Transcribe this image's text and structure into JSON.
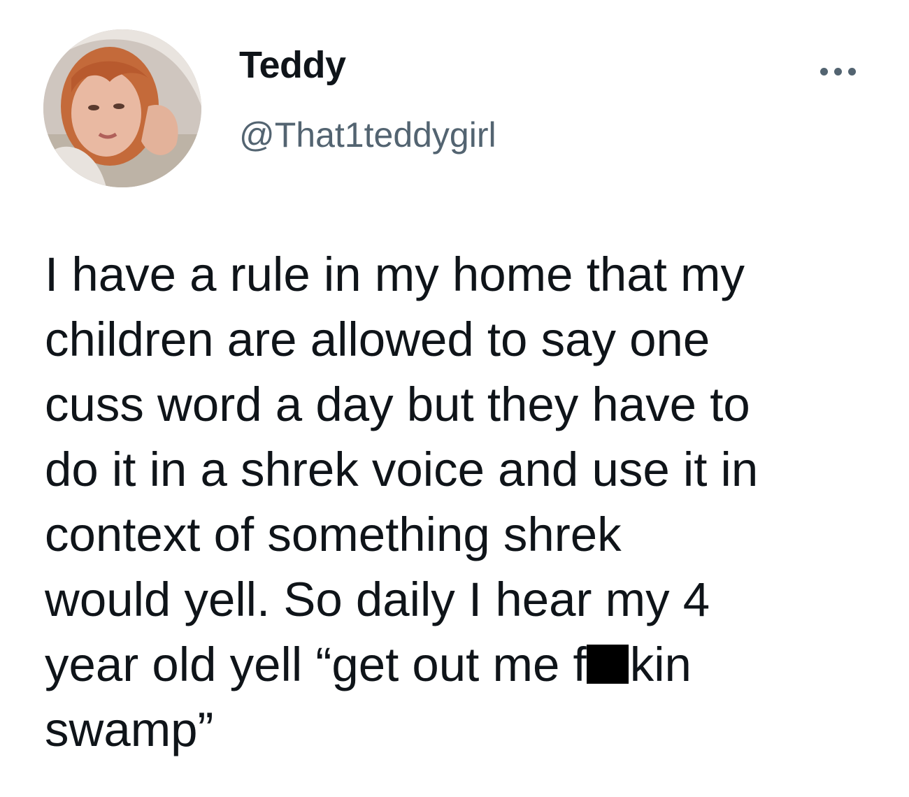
{
  "author": {
    "display_name": "Teddy",
    "handle": "@That1teddygirl"
  },
  "more_icon": "more-horizontal-icon",
  "tweet": {
    "lines": [
      "I have a rule in my home that my",
      "children are allowed to say one",
      "cuss word a day but they have to",
      "do it in a shrek voice and use it in",
      "context of something shrek",
      "would yell. So daily I hear my 4"
    ],
    "line7_before": "year old yell “get out me f",
    "line7_after": "kin",
    "line8": "swamp”"
  },
  "colors": {
    "text": "#0f1419",
    "secondary": "#536471",
    "background": "#ffffff"
  }
}
